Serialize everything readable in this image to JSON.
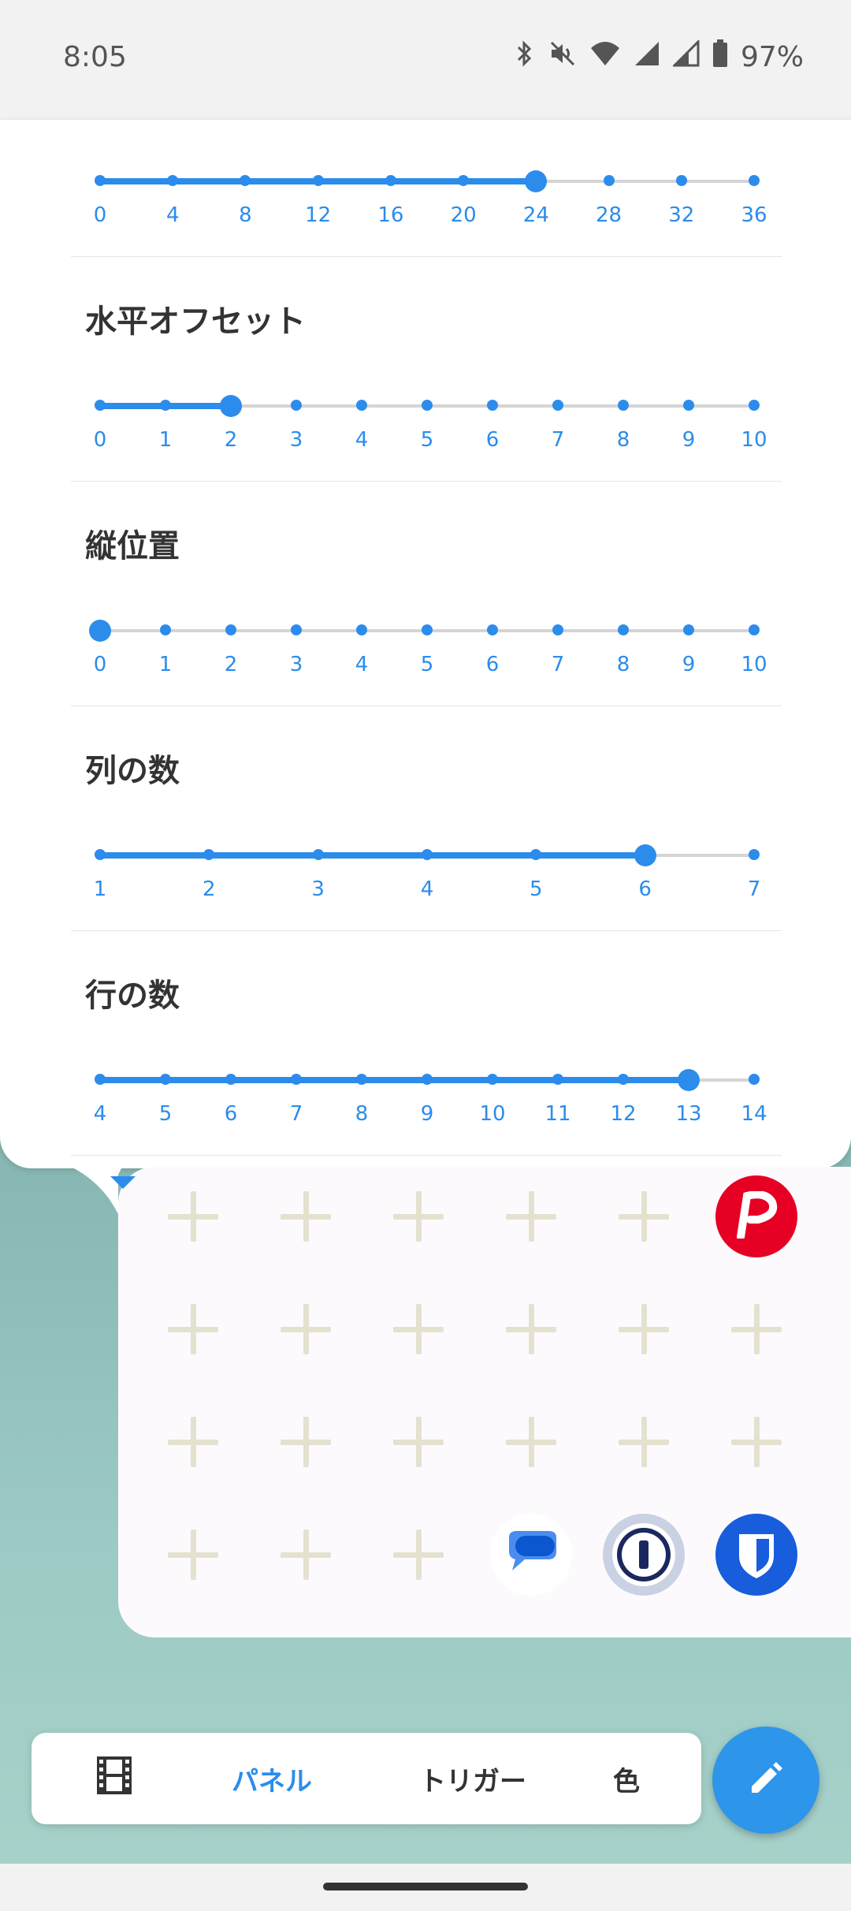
{
  "status_bar": {
    "time": "8:05",
    "battery": "97%",
    "icons": [
      "bluetooth-icon",
      "mute-icon",
      "wifi-icon",
      "signal-icon",
      "signal-icon",
      "battery-icon"
    ]
  },
  "settings": {
    "sections": [
      {
        "id": "top",
        "title": "",
        "labels": [
          "0",
          "4",
          "8",
          "12",
          "16",
          "20",
          "24",
          "28",
          "32",
          "36"
        ],
        "value_index": 6
      },
      {
        "id": "horizontal",
        "title": "水平オフセット",
        "labels": [
          "0",
          "1",
          "2",
          "3",
          "4",
          "5",
          "6",
          "7",
          "8",
          "9",
          "10"
        ],
        "value_index": 2
      },
      {
        "id": "vertical",
        "title": "縦位置",
        "labels": [
          "0",
          "1",
          "2",
          "3",
          "4",
          "5",
          "6",
          "7",
          "8",
          "9",
          "10"
        ],
        "value_index": 0
      },
      {
        "id": "columns",
        "title": "列の数",
        "labels": [
          "1",
          "2",
          "3",
          "4",
          "5",
          "6",
          "7"
        ],
        "value_index": 5
      },
      {
        "id": "rows",
        "title": "行の数",
        "labels": [
          "4",
          "5",
          "6",
          "7",
          "8",
          "9",
          "10",
          "11",
          "12",
          "13",
          "14"
        ],
        "value_index": 9
      }
    ]
  },
  "panel": {
    "rows": [
      [
        "plus",
        "plus",
        "plus",
        "plus",
        "plus",
        "paypay"
      ],
      [
        "plus",
        "plus",
        "plus",
        "plus",
        "plus",
        "plus"
      ],
      [
        "plus",
        "plus",
        "plus",
        "plus",
        "plus",
        "plus"
      ],
      [
        "plus",
        "plus",
        "plus",
        "messages",
        "1password",
        "bitwarden"
      ]
    ]
  },
  "bottom_bar": {
    "tabs": [
      "",
      "パネル",
      "トリガー",
      "色"
    ],
    "active_index": 1,
    "film_icon": "film-icon",
    "fab_icon": "pencil-icon"
  },
  "colors": {
    "accent": "#2b8cec",
    "track": "#d4d4d4",
    "plus": "#e5e1cf"
  }
}
